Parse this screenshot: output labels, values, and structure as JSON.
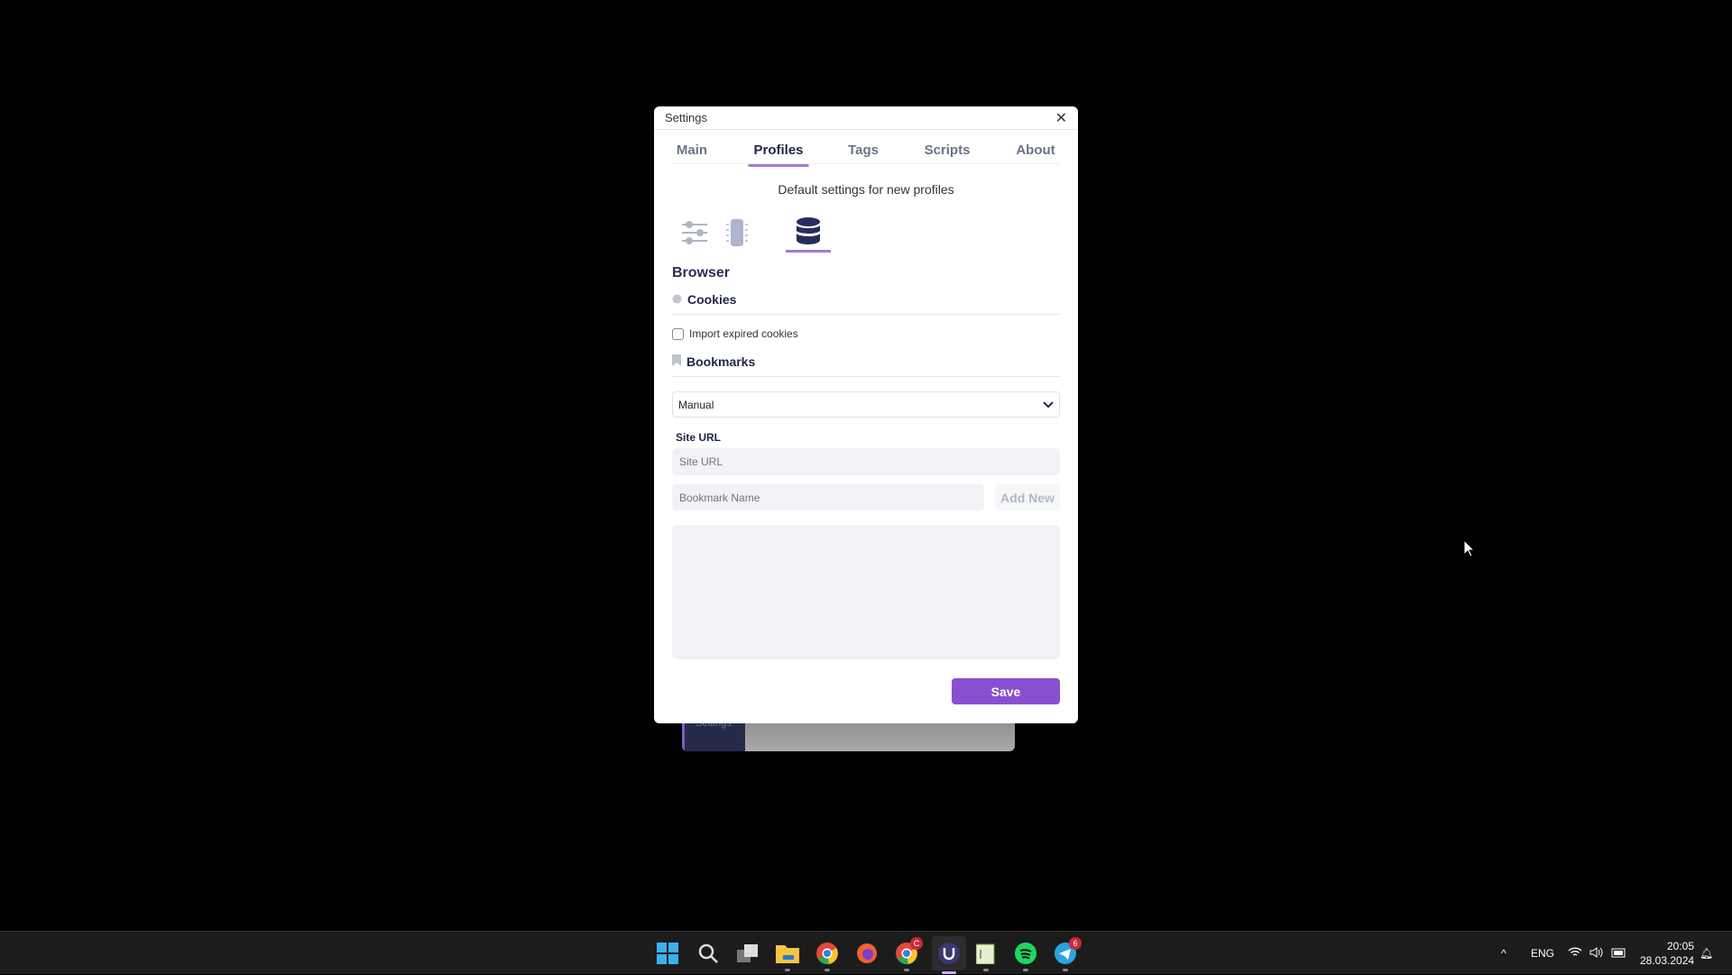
{
  "dialog": {
    "title": "Settings",
    "tabs": [
      {
        "label": "Main"
      },
      {
        "label": "Profiles",
        "active": true
      },
      {
        "label": "Tags"
      },
      {
        "label": "Scripts"
      },
      {
        "label": "About"
      }
    ],
    "subtitle": "Default settings for new profiles",
    "section_icons": [
      {
        "icon": "sliders-icon"
      },
      {
        "icon": "chip-icon"
      },
      {
        "icon": "database-icon",
        "active": true
      }
    ],
    "heading": "Browser",
    "cookies": {
      "title": "Cookies",
      "import_expired_label": "Import expired cookies",
      "import_expired_checked": false
    },
    "bookmarks": {
      "title": "Bookmarks",
      "mode_select": "Manual",
      "site_url_label": "Site URL",
      "site_url_placeholder": "Site URL",
      "bookmark_name_placeholder": "Bookmark Name",
      "add_new_label": "Add New"
    },
    "save_label": "Save",
    "accent": "#8a4fd0"
  },
  "background_window": {
    "label": "Settings"
  },
  "taskbar": {
    "apps": [
      "start",
      "search",
      "task-view",
      "file-explorer",
      "chrome",
      "firefox",
      "chrome-profile",
      "undetectable",
      "notepad",
      "spotify",
      "telegram"
    ],
    "chrome_profile_badge": "C",
    "telegram_badge": "6",
    "language": "ENG",
    "time": "20:05",
    "date": "28.03.2024"
  }
}
